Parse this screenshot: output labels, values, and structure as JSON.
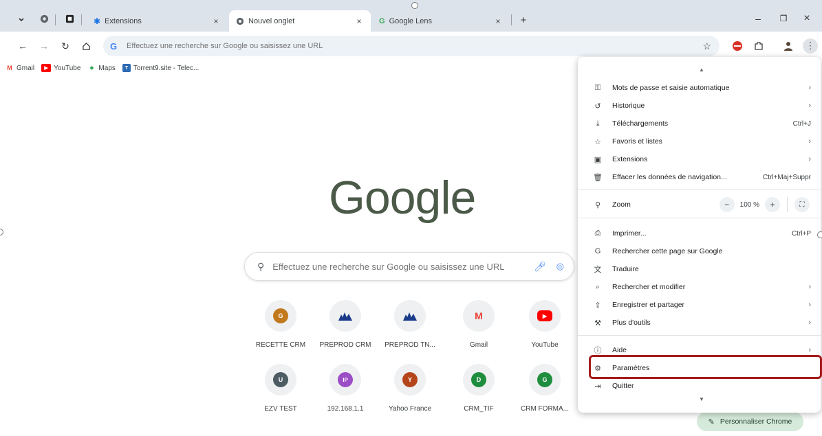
{
  "tabs": [
    {
      "title": "Extensions",
      "close": "×"
    },
    {
      "title": "Nouvel onglet",
      "close": "×"
    },
    {
      "title": "Google Lens",
      "close": "×"
    }
  ],
  "new_tab": "+",
  "window": {
    "minimize": "–",
    "maximize": "❐",
    "close": "×"
  },
  "omnibox": {
    "placeholder": "Effectuez une recherche sur Google ou saisissez une URL"
  },
  "bookmarks": [
    {
      "label": "Gmail"
    },
    {
      "label": "YouTube"
    },
    {
      "label": "Maps"
    },
    {
      "label": "Torrent9.site - Telec..."
    }
  ],
  "logo": "Google",
  "search": {
    "placeholder": "Effectuez une recherche sur Google ou saisissez une URL"
  },
  "shortcuts_row1": [
    {
      "label": "RECETTE CRM",
      "letter": "G",
      "color": "#c2791e"
    },
    {
      "label": "PREPROD CRM",
      "letter": "",
      "color": "#1a3a8a"
    },
    {
      "label": "PREPROD TN...",
      "letter": "",
      "color": "#1a3a8a"
    },
    {
      "label": "Gmail",
      "letter": "M",
      "color": "#ea4335"
    },
    {
      "label": "YouTube",
      "letter": "▶",
      "color": "#ff0000"
    }
  ],
  "shortcuts_row2": [
    {
      "label": "EZV TEST",
      "letter": "U",
      "color": "#4d5b63"
    },
    {
      "label": "192.168.1.1",
      "letter": "IP",
      "color": "#9c4ec7"
    },
    {
      "label": "Yahoo France",
      "letter": "Y",
      "color": "#b5451b"
    },
    {
      "label": "CRM_TIF",
      "letter": "D",
      "color": "#1e8e3e"
    },
    {
      "label": "CRM FORMA...",
      "letter": "G",
      "color": "#1e8e3e"
    }
  ],
  "customize": "Personnaliser Chrome",
  "menu": {
    "items": [
      {
        "label": "Mots de passe et saisie automatique",
        "shortcut": "",
        "arrow": "›"
      },
      {
        "label": "Historique",
        "shortcut": "",
        "arrow": "›"
      },
      {
        "label": "Téléchargements",
        "shortcut": "Ctrl+J",
        "arrow": ""
      },
      {
        "label": "Favoris et listes",
        "shortcut": "",
        "arrow": "›"
      },
      {
        "label": "Extensions",
        "shortcut": "",
        "arrow": "›"
      },
      {
        "label": "Effacer les données de navigation...",
        "shortcut": "Ctrl+Maj+Suppr",
        "arrow": ""
      }
    ],
    "zoom": {
      "label": "Zoom",
      "minus": "−",
      "value": "100 %",
      "plus": "+"
    },
    "items2": [
      {
        "label": "Imprimer...",
        "shortcut": "Ctrl+P",
        "arrow": ""
      },
      {
        "label": "Rechercher cette page sur Google",
        "shortcut": "",
        "arrow": ""
      },
      {
        "label": "Traduire",
        "shortcut": "",
        "arrow": ""
      },
      {
        "label": "Rechercher et modifier",
        "shortcut": "",
        "arrow": "›"
      },
      {
        "label": "Enregistrer et partager",
        "shortcut": "",
        "arrow": "›"
      },
      {
        "label": "Plus d'outils",
        "shortcut": "",
        "arrow": "›"
      }
    ],
    "items3": [
      {
        "label": "Aide",
        "shortcut": "",
        "arrow": "›"
      },
      {
        "label": "Paramètres",
        "shortcut": "",
        "arrow": ""
      },
      {
        "label": "Quitter",
        "shortcut": "",
        "arrow": ""
      }
    ]
  }
}
